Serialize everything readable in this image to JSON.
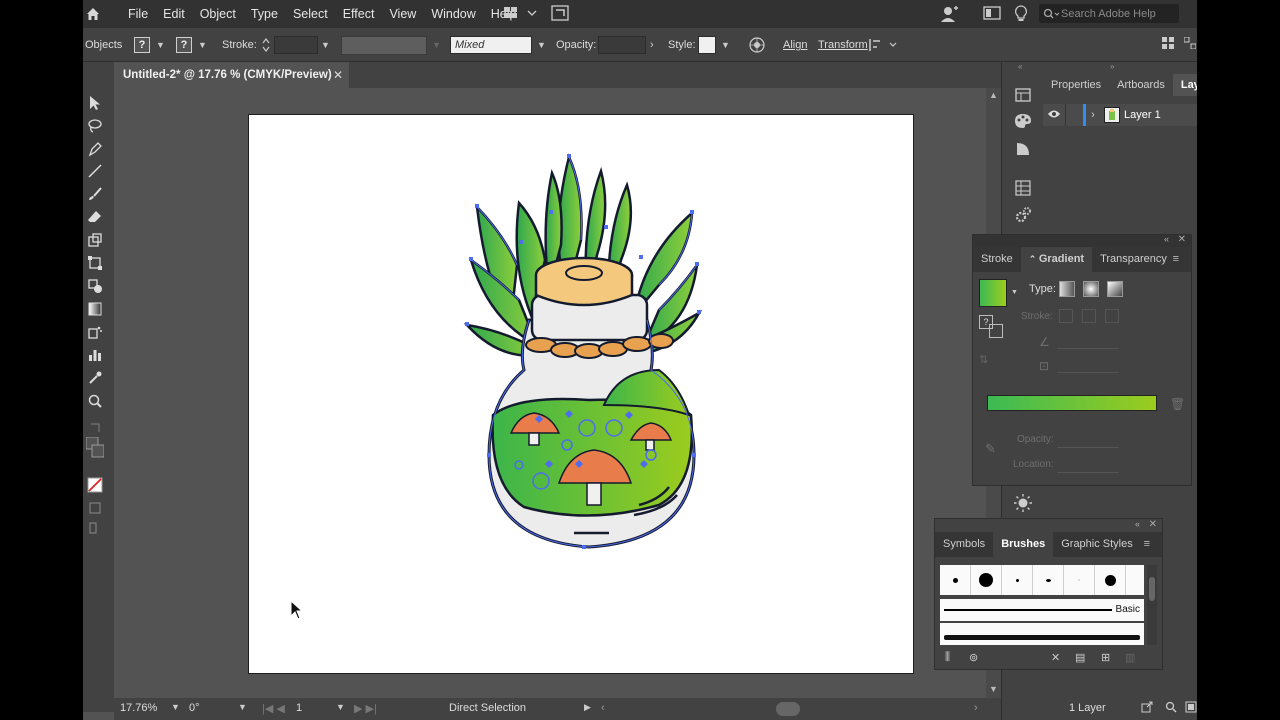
{
  "menubar": {
    "items": [
      "File",
      "Edit",
      "Object",
      "Type",
      "Select",
      "Effect",
      "View",
      "Window",
      "Help"
    ],
    "search_placeholder": "Search Adobe Help"
  },
  "control": {
    "objects_label": "Objects",
    "stroke_label": "Stroke:",
    "mixed_value": "Mixed",
    "opacity_label": "Opacity:",
    "style_label": "Style:",
    "align_label": "Align",
    "transform_label": "Transform",
    "fill_mixed": "?",
    "stroke_mixed": "?"
  },
  "document": {
    "tab_title": "Untitled-2* @ 17.76 % (CMYK/Preview)"
  },
  "status": {
    "zoom": "17.76%",
    "rotation": "0°",
    "artboard": "1",
    "tool": "Direct Selection"
  },
  "properties_panel": {
    "tabs": [
      "Properties",
      "Artboards",
      "Laye"
    ],
    "layer_name": "Layer 1",
    "footer_count": "1 Layer"
  },
  "gradient_panel": {
    "tabs": [
      "Stroke",
      "Gradient",
      "Transparency"
    ],
    "type_label": "Type:",
    "stroke_label": "Stroke:",
    "opacity_label": "Opacity:",
    "location_label": "Location:",
    "gradient_start": "#3cba54",
    "gradient_end": "#9ccc1e"
  },
  "brushes_panel": {
    "tabs": [
      "Symbols",
      "Brushes",
      "Graphic Styles"
    ],
    "basic_label": "Basic"
  },
  "colors": {
    "accent": "#2f8ef5",
    "app_bg": "#535353",
    "panel_bg": "#424242"
  }
}
